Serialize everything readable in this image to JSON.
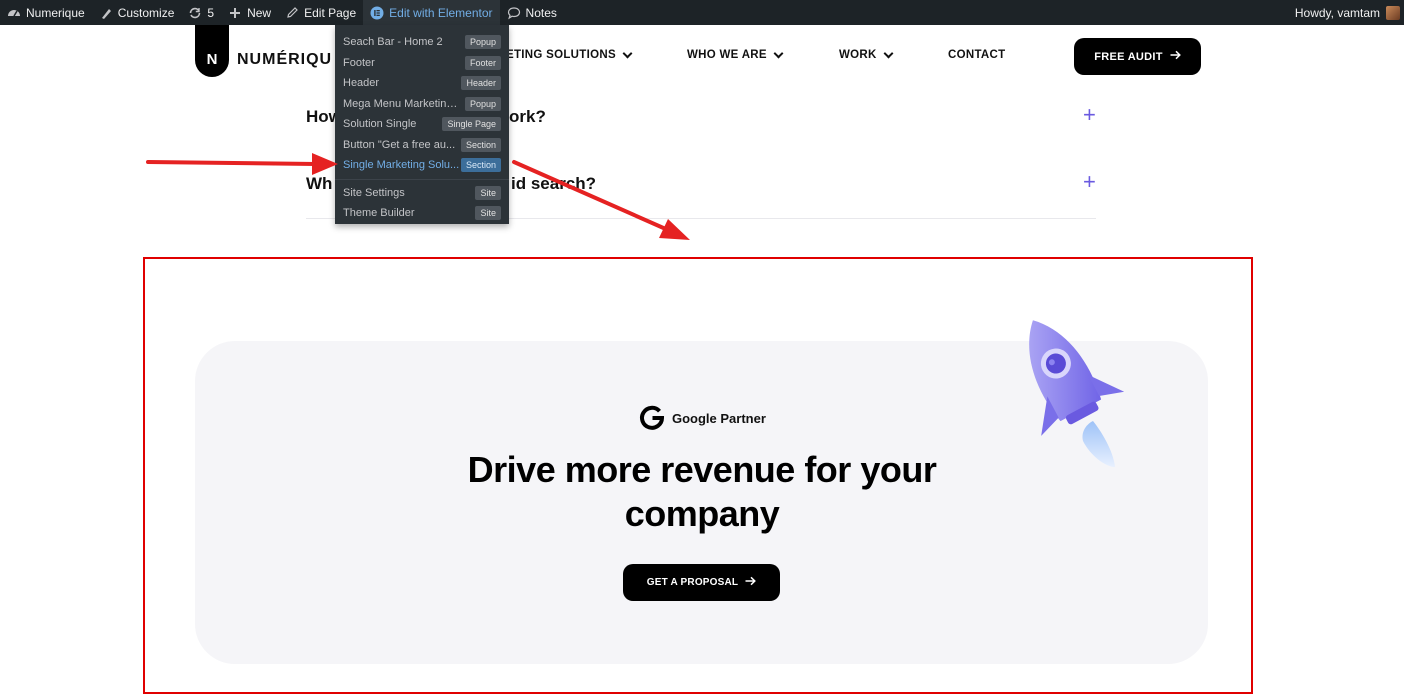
{
  "admin_bar": {
    "site_name": "Numerique",
    "customize": "Customize",
    "updates_count": "5",
    "new": "New",
    "edit_page": "Edit Page",
    "edit_elementor": "Edit with Elementor",
    "notes": "Notes",
    "howdy": "Howdy, vamtam"
  },
  "elementor_menu": {
    "items": [
      {
        "label": "Seach Bar - Home 2",
        "badge": "Popup"
      },
      {
        "label": "Footer",
        "badge": "Footer"
      },
      {
        "label": "Header",
        "badge": "Header"
      },
      {
        "label": "Mega Menu Marketing ...",
        "badge": "Popup"
      },
      {
        "label": "Solution Single",
        "badge": "Single Page"
      },
      {
        "label": "Button \"Get a free au...",
        "badge": "Section"
      },
      {
        "label": "Single Marketing Solu...",
        "badge": "Section"
      }
    ],
    "site_items": [
      {
        "label": "Site Settings",
        "badge": "Site"
      },
      {
        "label": "Theme Builder",
        "badge": "Site"
      }
    ]
  },
  "header": {
    "logo_letter": "N",
    "logo_text": "NUMÉRIQU",
    "nav": [
      {
        "label": "ETING SOLUTIONS"
      },
      {
        "label": "WHO WE ARE"
      },
      {
        "label": "WORK"
      },
      {
        "label": "CONTACT"
      }
    ],
    "cta": "FREE AUDIT"
  },
  "faq": [
    {
      "visible_start": "How",
      "visible_end": "ork?"
    },
    {
      "visible_start": "Wh",
      "visible_end": "id search?"
    }
  ],
  "cta_section": {
    "badge": "Google Partner",
    "title_line1": "Drive more revenue for your",
    "title_line2": "company",
    "button": "GET A PROPOSAL"
  },
  "colors": {
    "admin_bar_bg": "#1d2327",
    "accent_purple": "#6a5ae0",
    "highlight_red": "#e00000",
    "elementor_blue": "#72aee6"
  }
}
